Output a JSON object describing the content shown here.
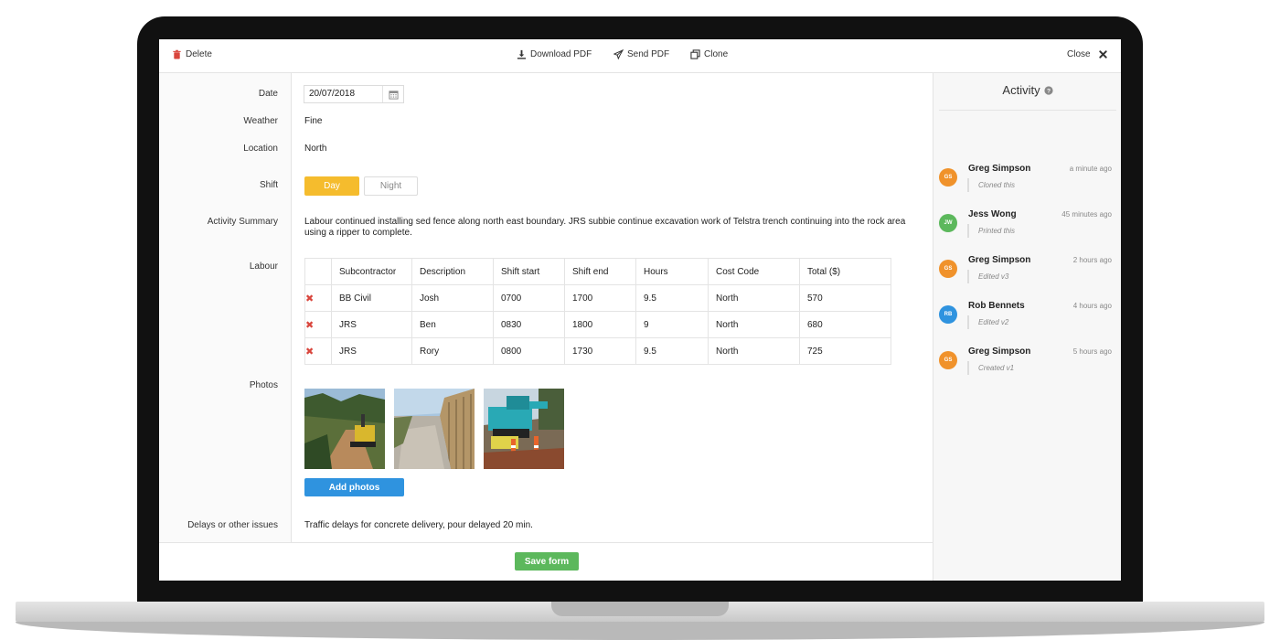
{
  "toolbar": {
    "delete_label": "Delete",
    "download_label": "Download PDF",
    "send_label": "Send PDF",
    "clone_label": "Clone",
    "close_label": "Close"
  },
  "form": {
    "date_label": "Date",
    "date_value": "20/07/2018",
    "weather_label": "Weather",
    "weather_value": "Fine",
    "location_label": "Location",
    "location_value": "North",
    "shift_label": "Shift",
    "shift_options": [
      "Day",
      "Night"
    ],
    "shift_selected": "Day",
    "summary_label": "Activity Summary",
    "summary_value": "Labour continued installing sed fence along north east boundary.  JRS subbie continue excavation work of Telstra trench continuing into the rock area using a ripper to complete.",
    "labour_label": "Labour",
    "photos_label": "Photos",
    "add_photos_label": "Add photos",
    "delays_label": "Delays or other issues",
    "delays_value": "Traffic delays for concrete delivery, pour delayed 20 min.",
    "save_label": "Save form"
  },
  "labour": {
    "headers": [
      "Subcontractor",
      "Description",
      "Shift start",
      "Shift end",
      "Hours",
      "Cost Code",
      "Total ($)"
    ],
    "rows": [
      [
        "BB Civil",
        "Josh",
        "0700",
        "1700",
        "9.5",
        "North",
        "570"
      ],
      [
        "JRS",
        "Ben",
        "0830",
        "1800",
        "9",
        "North",
        "680"
      ],
      [
        "JRS",
        "Rory",
        "0800",
        "1730",
        "9.5",
        "North",
        "725"
      ]
    ]
  },
  "activity": {
    "title": "Activity",
    "items": [
      {
        "initials": "GS",
        "name": "Greg Simpson",
        "time": "a minute ago",
        "note": "Cloned this",
        "color": "#f0922b"
      },
      {
        "initials": "JW",
        "name": "Jess Wong",
        "time": "45 minutes ago",
        "note": "Printed this",
        "color": "#5cb85c"
      },
      {
        "initials": "GS",
        "name": "Greg Simpson",
        "time": "2 hours ago",
        "note": "Edited v3",
        "color": "#f0922b"
      },
      {
        "initials": "RB",
        "name": "Rob Bennets",
        "time": "4 hours ago",
        "note": "Edited v2",
        "color": "#2f93df"
      },
      {
        "initials": "GS",
        "name": "Greg Simpson",
        "time": "5 hours ago",
        "note": "Created v1",
        "color": "#f0922b"
      }
    ]
  },
  "colors": {
    "accent_yellow": "#f5bc2d",
    "primary_blue": "#2f93df",
    "success_green": "#5cb85c",
    "danger_red": "#d9463d"
  }
}
